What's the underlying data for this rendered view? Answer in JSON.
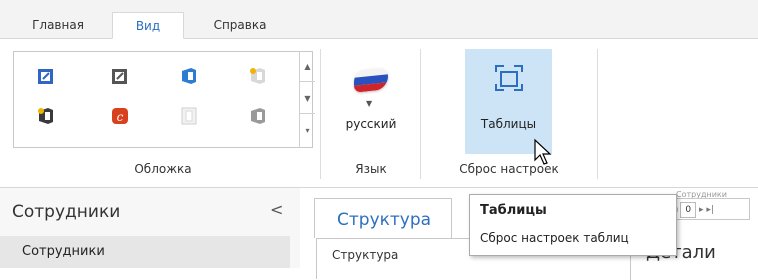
{
  "ribbon_tabs": [
    {
      "label": "Главная",
      "active": false
    },
    {
      "label": "Вид",
      "active": true
    },
    {
      "label": "Справка",
      "active": false
    }
  ],
  "skins_group": {
    "label": "Обложка",
    "skins": [
      "skin-blue-icon",
      "skin-gray-icon",
      "skin-office-blue-icon",
      "skin-office-light-icon",
      "skin-office-dark-icon",
      "skin-red-c-icon",
      "skin-glass-icon",
      "skin-frame-icon"
    ]
  },
  "language_group": {
    "label": "Язык",
    "button_label": "русский",
    "flag_icon": "russia-flag-icon"
  },
  "reset_group": {
    "label": "Сброс настроек",
    "button_label": "Таблицы",
    "icon": "reset-tables-icon"
  },
  "left_panel": {
    "title": "Сотрудники",
    "collapse_glyph": "<",
    "selected_item": "Сотрудники"
  },
  "content": {
    "tab_label": "Структура",
    "sub_label": "Структура",
    "details_label": "Детали",
    "pager_caption": "Сотрудники",
    "pager_value": "0"
  },
  "tooltip": {
    "title": "Таблицы",
    "description": "Сброс настроек таблиц"
  },
  "colors": {
    "accent": "#2d6fbf",
    "hover": "#cde4f7",
    "panel": "#f7f7f7"
  }
}
